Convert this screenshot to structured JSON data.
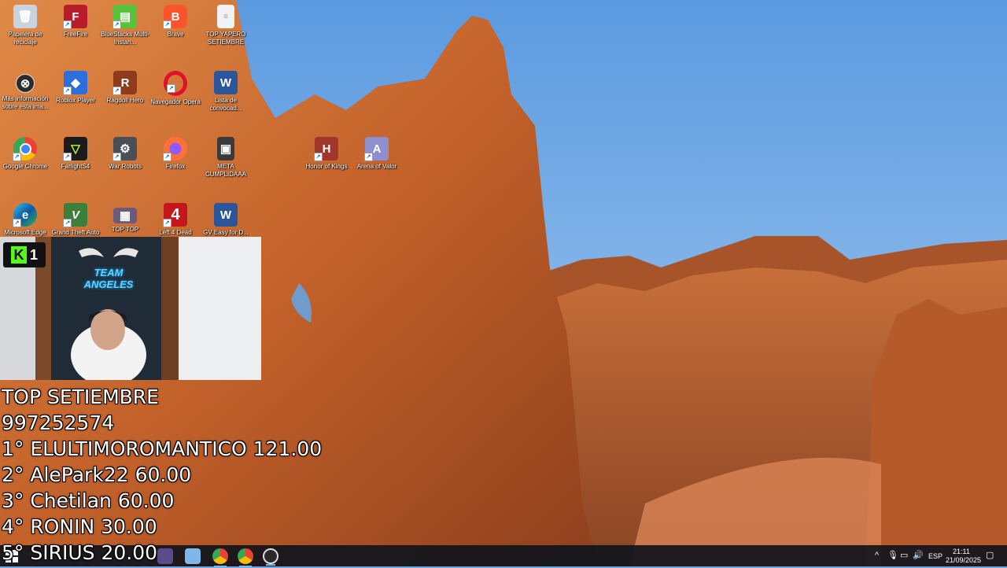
{
  "desktop_icons": [
    {
      "label": "Papelera de reciclaje",
      "icon": "recycle-bin-icon"
    },
    {
      "label": "FreeFire",
      "icon": "freefire-icon"
    },
    {
      "label": "BlueStacks Multi-Instan...",
      "icon": "bluestacks-multi-icon"
    },
    {
      "label": "Brave",
      "icon": "brave-icon"
    },
    {
      "label": "TOP YAPERO SETIEMBRE",
      "icon": "text-file-icon"
    },
    {
      "label": "Más información sobre esta ima...",
      "icon": "spotlight-info-icon"
    },
    {
      "label": "Roblox Player",
      "icon": "roblox-icon"
    },
    {
      "label": "Ragdoll Hero",
      "icon": "ragdoll-hero-icon"
    },
    {
      "label": "Navegador Opera",
      "icon": "opera-icon"
    },
    {
      "label": "Lista de convocad...",
      "icon": "word-doc-icon"
    },
    {
      "label": "Google Chrome",
      "icon": "chrome-icon"
    },
    {
      "label": "FarlightS4",
      "icon": "farlight-icon"
    },
    {
      "label": "War Robots",
      "icon": "war-robots-icon"
    },
    {
      "label": "Firefox",
      "icon": "firefox-icon"
    },
    {
      "label": "META CUMPLIDAAA",
      "icon": "image-file-icon"
    },
    {
      "label": "Honor of Kings",
      "icon": "honor-of-kings-icon"
    },
    {
      "label": "Arena of Valor",
      "icon": "arena-of-valor-icon"
    },
    {
      "label": "Microsoft Edge",
      "icon": "edge-icon"
    },
    {
      "label": "Grand Theft Auto V",
      "icon": "gta-v-icon"
    },
    {
      "label": "TOP TOP",
      "icon": "image-file-icon"
    },
    {
      "label": "Left 4 Dead",
      "icon": "left4dead-icon"
    },
    {
      "label": "GV Easy for D...",
      "icon": "word-doc-icon"
    }
  ],
  "webcam": {
    "kick_number": "1",
    "banner_text": "TEAM ANGELES"
  },
  "overlay": {
    "title": "TOP  SETIEMBRE",
    "phone": "997252574",
    "ranks": [
      "1° ELULTIMOROMANTICO  121.00",
      "2° AlePark22 60.00",
      "3° Chetilan 60.00",
      "4° RONIN 30.00",
      "5° SIRIUS 20.00"
    ]
  },
  "taskbar": {
    "apps": [
      "windows-start-icon",
      "search-icon",
      "file-explorer-icon",
      "chrome-icon",
      "chrome-icon",
      "obs-icon"
    ],
    "language": "ESP",
    "time": "21:11",
    "date": "21/09/2025"
  },
  "colors": {
    "sky": "#6fa8e0",
    "rock": "#c8662e",
    "taskbar": "#10141c",
    "kick_green": "#53fc18"
  }
}
